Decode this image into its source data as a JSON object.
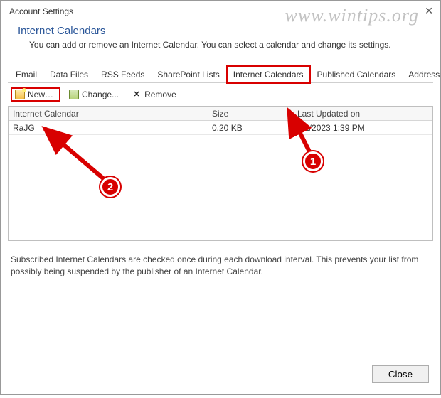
{
  "window": {
    "title": "Account Settings"
  },
  "watermark": "www.wintips.org",
  "header": {
    "title": "Internet Calendars",
    "description": "You can add or remove an Internet Calendar. You can select a calendar and change its settings."
  },
  "tabs": {
    "email": "Email",
    "data_files": "Data Files",
    "rss": "RSS Feeds",
    "sharepoint": "SharePoint Lists",
    "internet_cal": "Internet Calendars",
    "published_cal": "Published Calendars",
    "address_books": "Address Books"
  },
  "toolbar": {
    "new_label": "New…",
    "change_label": "Change...",
    "remove_label": "Remove"
  },
  "list": {
    "col1": "Internet Calendar",
    "col2": "Size",
    "col3": "Last Updated on",
    "rows": [
      {
        "name": "RaJG",
        "size": "0.20 KB",
        "updated": "5/1/2023 1:39 PM"
      }
    ]
  },
  "footer_note": "Subscribed Internet Calendars are checked once during each download interval. This prevents your list from possibly being suspended by the publisher of an Internet Calendar.",
  "close_button": "Close",
  "annotations": {
    "badge1": "1",
    "badge2": "2"
  }
}
